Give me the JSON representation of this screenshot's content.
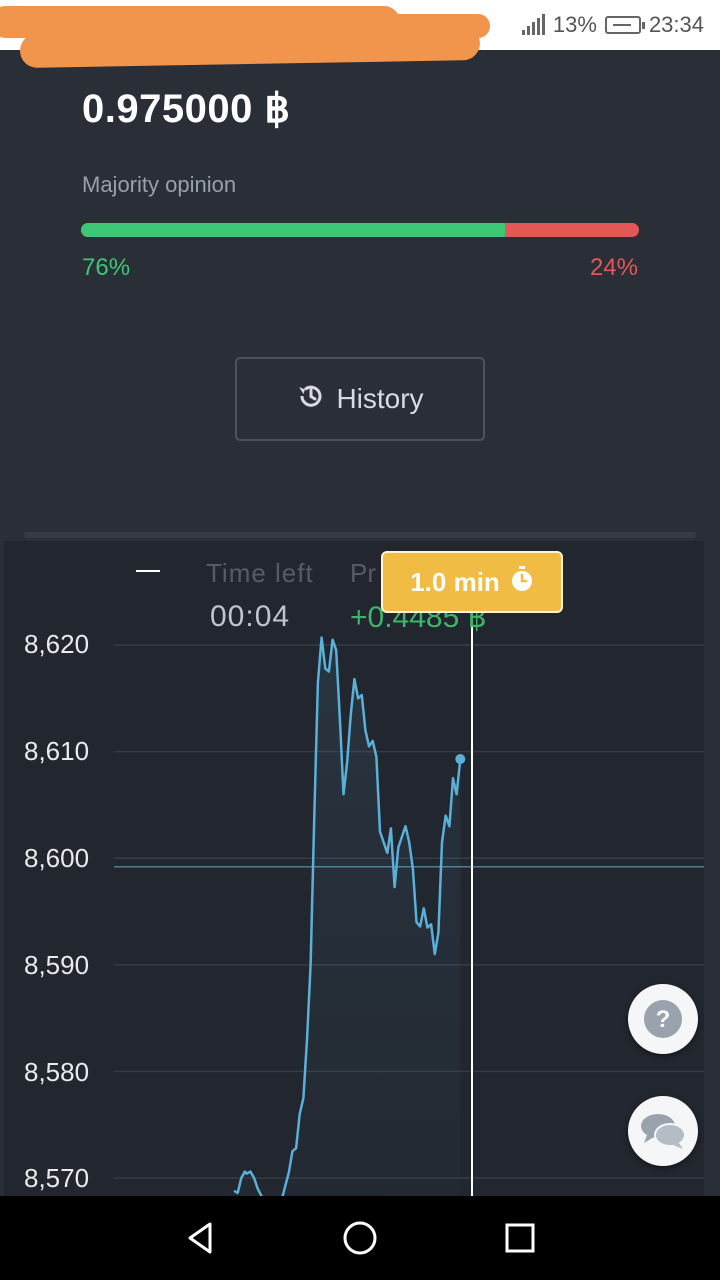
{
  "status_bar": {
    "battery": "13%",
    "time": "23:34"
  },
  "bet": {
    "amount": "0.975000 ฿"
  },
  "majority": {
    "label": "Majority opinion",
    "up_pct": "76%",
    "down_pct": "24%",
    "up_fraction": 0.76,
    "colors": {
      "up": "#3cc775",
      "down": "#e35757"
    }
  },
  "history_button": {
    "label": "History",
    "icon": "history-icon"
  },
  "trade": {
    "collapse_icon": "minus-icon",
    "time_left_label": "Time left",
    "time_left_value": "00:04",
    "profit_label_partial": "Pr",
    "profit_value": "+0.4485 ฿"
  },
  "tooltip": {
    "label": "1.0 min",
    "icon": "stopwatch-icon",
    "color": "#f1bc43"
  },
  "chart_data": {
    "type": "line",
    "y_ticks": [
      "8,620",
      "8,610",
      "8,600",
      "8,590",
      "8,580",
      "8,570"
    ],
    "ylim": [
      8568,
      8622
    ],
    "grid": true,
    "entry_price": 8599.2,
    "series": [
      {
        "color": "#5ab0d8",
        "points": [
          [
            0,
            8568.8
          ],
          [
            2,
            8568.6
          ],
          [
            4,
            8570.0
          ],
          [
            6,
            8570.6
          ],
          [
            7,
            8570.4
          ],
          [
            9,
            8570.6
          ],
          [
            11,
            8570.0
          ],
          [
            13,
            8569.0
          ],
          [
            16,
            8568.0
          ],
          [
            19,
            8566.5
          ],
          [
            22,
            8566.0
          ],
          [
            25,
            8567.2
          ],
          [
            28,
            8569.2
          ],
          [
            30,
            8570.5
          ],
          [
            32,
            8572.5
          ],
          [
            34,
            8572.8
          ],
          [
            36,
            8576.0
          ],
          [
            38,
            8577.5
          ],
          [
            40,
            8583.0
          ],
          [
            42,
            8590.0
          ],
          [
            44,
            8604.0
          ],
          [
            46,
            8616.5
          ],
          [
            48,
            8620.7
          ],
          [
            50,
            8617.8
          ],
          [
            52,
            8617.5
          ],
          [
            54,
            8620.5
          ],
          [
            56,
            8619.5
          ],
          [
            58,
            8613.0
          ],
          [
            60,
            8606.0
          ],
          [
            62,
            8609.0
          ],
          [
            64,
            8613.5
          ],
          [
            66,
            8616.8
          ],
          [
            68,
            8615.0
          ],
          [
            70,
            8615.3
          ],
          [
            72,
            8612.0
          ],
          [
            74,
            8610.5
          ],
          [
            76,
            8611.0
          ],
          [
            78,
            8609.5
          ],
          [
            80,
            8602.5
          ],
          [
            82,
            8601.5
          ],
          [
            84,
            8600.5
          ],
          [
            86,
            8602.8
          ],
          [
            88,
            8597.3
          ],
          [
            90,
            8601.0
          ],
          [
            92,
            8602.0
          ],
          [
            94,
            8603.0
          ],
          [
            96,
            8601.5
          ],
          [
            98,
            8599.0
          ],
          [
            100,
            8594.0
          ],
          [
            102,
            8593.6
          ],
          [
            104,
            8595.3
          ],
          [
            106,
            8593.5
          ],
          [
            108,
            8593.8
          ],
          [
            110,
            8591.0
          ],
          [
            112,
            8593.0
          ],
          [
            114,
            8601.5
          ],
          [
            116,
            8604.0
          ],
          [
            118,
            8603.0
          ],
          [
            120,
            8607.5
          ],
          [
            122,
            8606.0
          ],
          [
            124,
            8609.3
          ]
        ]
      }
    ]
  }
}
